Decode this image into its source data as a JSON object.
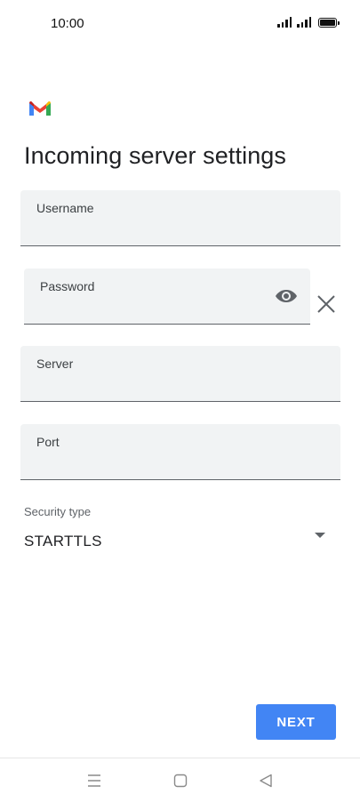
{
  "status_bar": {
    "time": "10:00",
    "icons": [
      "signal-icon",
      "signal-icon",
      "battery-icon"
    ]
  },
  "app": {
    "logo": "gmail-logo",
    "title": "Incoming server settings"
  },
  "form": {
    "username": {
      "label": "Username",
      "value": ""
    },
    "password": {
      "label": "Password",
      "value": "",
      "icons": [
        "eye-icon",
        "close-icon"
      ]
    },
    "server": {
      "label": "Server",
      "value": ""
    },
    "port": {
      "label": "Port",
      "value": ""
    },
    "security": {
      "label": "Security type",
      "value": "STARTTLS",
      "icon": "dropdown-arrow-icon"
    }
  },
  "actions": {
    "next_label": "NEXT"
  },
  "navigation": {
    "buttons": [
      "menu-icon",
      "home-icon",
      "back-icon"
    ]
  },
  "colors": {
    "accent": "#4285f4",
    "field_bg": "#f1f3f4",
    "text": "#202124",
    "secondary_text": "#5f6368"
  }
}
